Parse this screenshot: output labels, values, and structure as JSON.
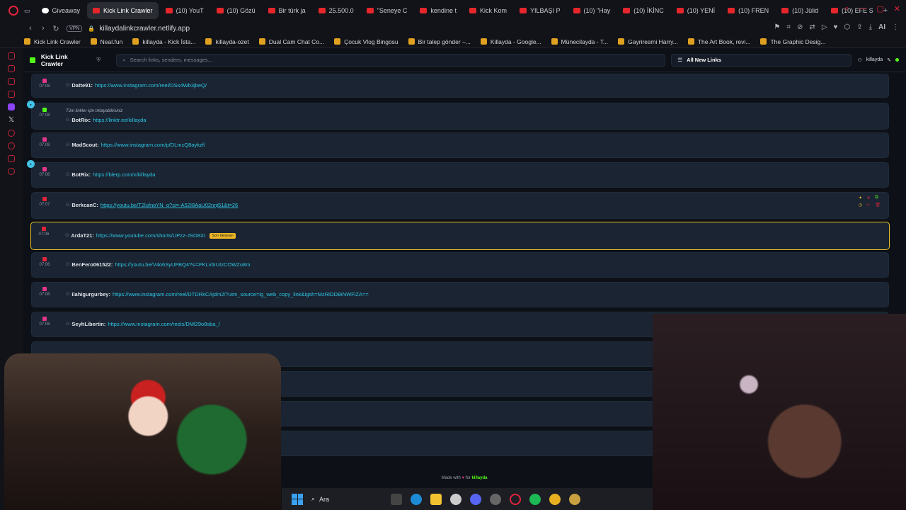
{
  "tabs": [
    {
      "label": "Giveaway",
      "fav": "white"
    },
    {
      "label": "Kick Link Crawler",
      "fav": "red",
      "active": true
    },
    {
      "label": "(10) YouT",
      "fav": "red"
    },
    {
      "label": "(10) Gözü",
      "fav": "red"
    },
    {
      "label": "Bir türk ja",
      "fav": "red"
    },
    {
      "label": "25.500.0",
      "fav": "red"
    },
    {
      "label": "\"Seneye C",
      "fav": "red"
    },
    {
      "label": "kendine t",
      "fav": "red"
    },
    {
      "label": "Kick Kom",
      "fav": "red"
    },
    {
      "label": "YILBAŞI P",
      "fav": "red"
    },
    {
      "label": "(10) \"Hay",
      "fav": "red"
    },
    {
      "label": "(10) İKİNC",
      "fav": "red"
    },
    {
      "label": "(10) YENİ",
      "fav": "red"
    },
    {
      "label": "(10) FREN",
      "fav": "red"
    },
    {
      "label": "(10) Jülid",
      "fav": "red"
    },
    {
      "label": "(10) EFE S",
      "fav": "red"
    }
  ],
  "address": {
    "vpn": "VPN",
    "url": "killaydalinkcrawler.netlify.app",
    "ai": "AI"
  },
  "bookmarks": [
    "Kick Link Crawler",
    "Neal.fun",
    "killayda - Kick İsta...",
    "killayda-ozet",
    "Dual Cam Chat Co...",
    "Çocuk Vlog Bingosu",
    "Bir talep gönder –...",
    "Killayda - Google...",
    "Münecilayda - T...",
    "Gayriresmi Harry...",
    "The Art Book, revi...",
    "The Graphic Desig..."
  ],
  "app": {
    "brand": "Kick Link Crawler",
    "search_placeholder": "Search links, senders, messages...",
    "filter": "All New Links",
    "username": "killayda"
  },
  "rows": [
    {
      "time": "07:08",
      "sender": "Datte91:",
      "link": "https://www.instagram.com/reel/DSs4Wb3jbeQ/",
      "color": "pink"
    },
    {
      "time": "07:08",
      "sender": "BotRix:",
      "link": "https://linktr.ee/killayda",
      "color": "green",
      "note": "Tüm linkler için tıklayabilirsiniz",
      "bubble": true
    },
    {
      "time": "07:08",
      "sender": "MadScout:",
      "link": "https://www.instagram.com/p/DLmzQ8aykzf/",
      "color": "pink"
    },
    {
      "time": "07:08",
      "sender": "BotRix:",
      "link": "https://blerp.com/x/killayda",
      "color": "pink",
      "bubble": true
    },
    {
      "time": "07:07",
      "sender": "BerkcanC:",
      "link": "https://youtu.be/T2lufnoYN_g?si=-A52I8AaU02nnj51&t=26",
      "color": "red",
      "underline": true,
      "actions": true
    },
    {
      "time": "07:06",
      "sender": "ArdaT21:",
      "link": "https://www.youtube.com/shorts/UPzz-JSO8XI",
      "color": "red",
      "badge": "Son tıklanan",
      "highlight": true
    },
    {
      "time": "07:06",
      "sender": "BenFero061522:",
      "link": "https://youtu.be/V4o6SyUFBQ4?si=FKLvbIUIzCOWZu8m",
      "color": "red"
    },
    {
      "time": "07:06",
      "sender": "ilahigurgurbey:",
      "link": "https://www.instagram.com/reel/DTDRkCAjdm2/?utm_source=ig_web_copy_link&igsh=MzRlODBiNWFlZA==",
      "color": "pink"
    },
    {
      "time": "07:06",
      "sender": "SeyhLibertin:",
      "link": "https://www.instagram.com/reels/DMl29o8sba_/",
      "color": "pink"
    }
  ],
  "footer": {
    "prefix": "Made with",
    "suffix": "for",
    "name": "killayda"
  },
  "taskbar": {
    "search": "Ara"
  }
}
